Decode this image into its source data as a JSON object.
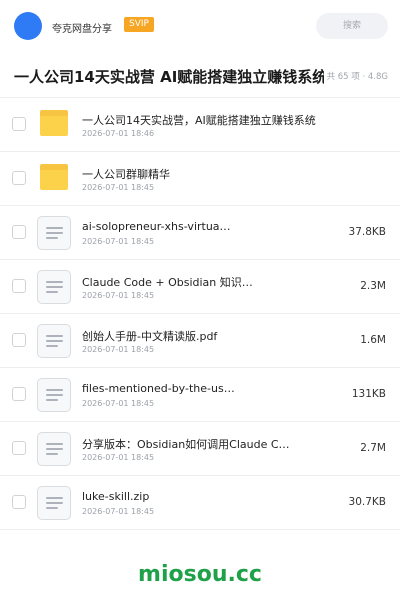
{
  "header": {
    "sharer_name": "夸克网盘分享",
    "badge": "SVIP",
    "search_placeholder": "搜索"
  },
  "share": {
    "title": "一人公司14天实战营 AI赋能搭建独立赚钱系统",
    "meta": "共 65 项 · 4.8G"
  },
  "files": [
    {
      "name": "一人公司14天实战营，AI赋能搭建独立赚钱系统",
      "date": "2026-07-01 18:46",
      "size": "",
      "type": "folder"
    },
    {
      "name": "一人公司群聊精华",
      "date": "2026-07-01 18:45",
      "size": "",
      "type": "folder"
    },
    {
      "name": "ai-solopreneur-xhs-virtua…",
      "date": "2026-07-01 18:45",
      "size": "37.8KB",
      "type": "file"
    },
    {
      "name": "Claude Code + Obsidian 知识…",
      "date": "2026-07-01 18:45",
      "size": "2.3M",
      "type": "file"
    },
    {
      "name": "创始人手册-中文精读版.pdf",
      "date": "2026-07-01 18:45",
      "size": "1.6M",
      "type": "file"
    },
    {
      "name": "files-mentioned-by-the-us…",
      "date": "2026-07-01 18:45",
      "size": "131KB",
      "type": "file"
    },
    {
      "name": "分享版本：Obsidian如何调用Claude C…",
      "date": "2026-07-01 18:45",
      "size": "2.7M",
      "type": "file"
    },
    {
      "name": "luke-skill.zip",
      "date": "2026-07-01 18:45",
      "size": "30.7KB",
      "type": "file"
    }
  ],
  "watermark": "miosou.cc",
  "colors": {
    "avatar": "#2f7bf5",
    "badge": "#f7a623",
    "folder": "#fbd249",
    "watermark": "#1fa14a"
  }
}
